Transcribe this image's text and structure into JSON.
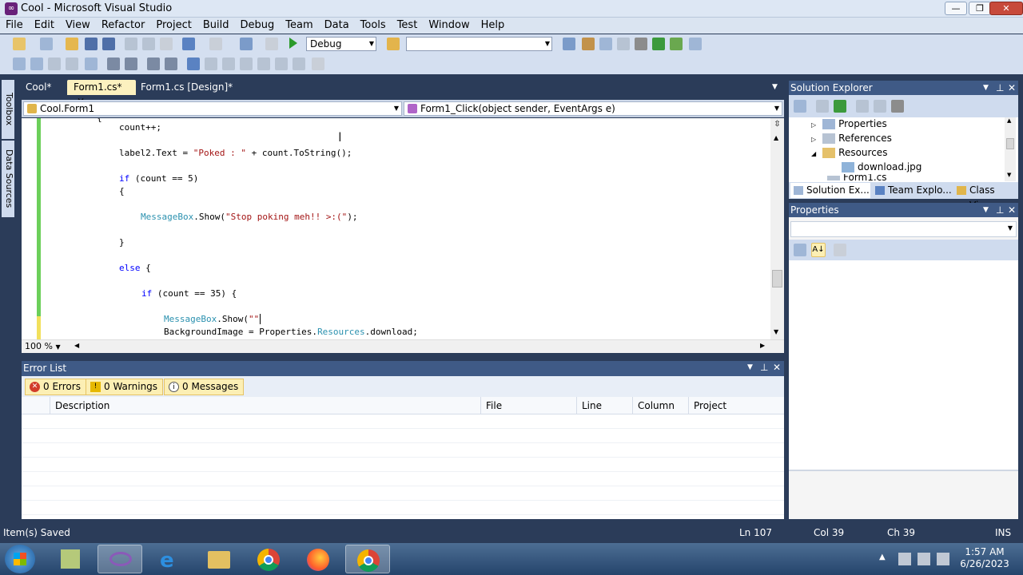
{
  "window": {
    "title": "Cool - Microsoft Visual Studio",
    "app_icon": "visual-studio-icon"
  },
  "menu": [
    "File",
    "Edit",
    "View",
    "Refactor",
    "Project",
    "Build",
    "Debug",
    "Team",
    "Data",
    "Tools",
    "Test",
    "Window",
    "Help"
  ],
  "toolbar": {
    "config": "Debug",
    "platform": ""
  },
  "left_tabs": {
    "toolbox": "Toolbox",
    "data_sources": "Data Sources"
  },
  "doc_tabs": [
    {
      "label": "Cool*",
      "active": false
    },
    {
      "label": "Form1.cs*",
      "active": true
    },
    {
      "label": "Form1.cs [Design]*",
      "active": false
    }
  ],
  "navbar": {
    "class_combo": "Cool.Form1",
    "member_combo": "Form1_Click(object sender, EventArgs e)"
  },
  "code_lines": {
    "l0": "{",
    "l1": "count++;",
    "l2a": "label2.Text = ",
    "l2b": "\"Poked : \"",
    "l2c": " + count.ToString();",
    "l3a": "if",
    "l3b": " (count == 5)",
    "l4": "{",
    "l5a": "MessageBox",
    "l5b": ".Show(",
    "l5c": "\"Stop poking meh!! >:(\"",
    "l5d": ");",
    "l6": "}",
    "l7a": "else",
    "l7b": " {",
    "l8a": "if",
    "l8b": " (count == 35) {",
    "l9a": "MessageBox",
    "l9b": ".Show(",
    "l9c": "\"\"",
    "l10a": "BackgroundImage = Properties.",
    "l10b": "Resources",
    "l10c": ".download;"
  },
  "zoom": "100 %",
  "error_list": {
    "title": "Error List",
    "errors": "0 Errors",
    "warnings": "0 Warnings",
    "messages": "0 Messages",
    "columns": [
      "Description",
      "File",
      "Line",
      "Column",
      "Project"
    ]
  },
  "solution_explorer": {
    "title": "Solution Explorer",
    "items": [
      "Properties",
      "References",
      "Resources",
      "download.jpg",
      "Form1.cs"
    ],
    "tabs": [
      "Solution Ex...",
      "Team Explo...",
      "Class View"
    ]
  },
  "properties_panel": {
    "title": "Properties"
  },
  "status": {
    "message": "Item(s) Saved",
    "ln": "Ln 107",
    "col": "Col 39",
    "ch": "Ch 39",
    "mode": "INS"
  },
  "taskbar": {
    "time": "1:57 AM",
    "date": "6/26/2023"
  },
  "colors": {
    "accent": "#3f5a86",
    "active_tab": "#fcf1bf",
    "keyword": "#0000ff",
    "string": "#a31515",
    "type": "#2b91af"
  }
}
